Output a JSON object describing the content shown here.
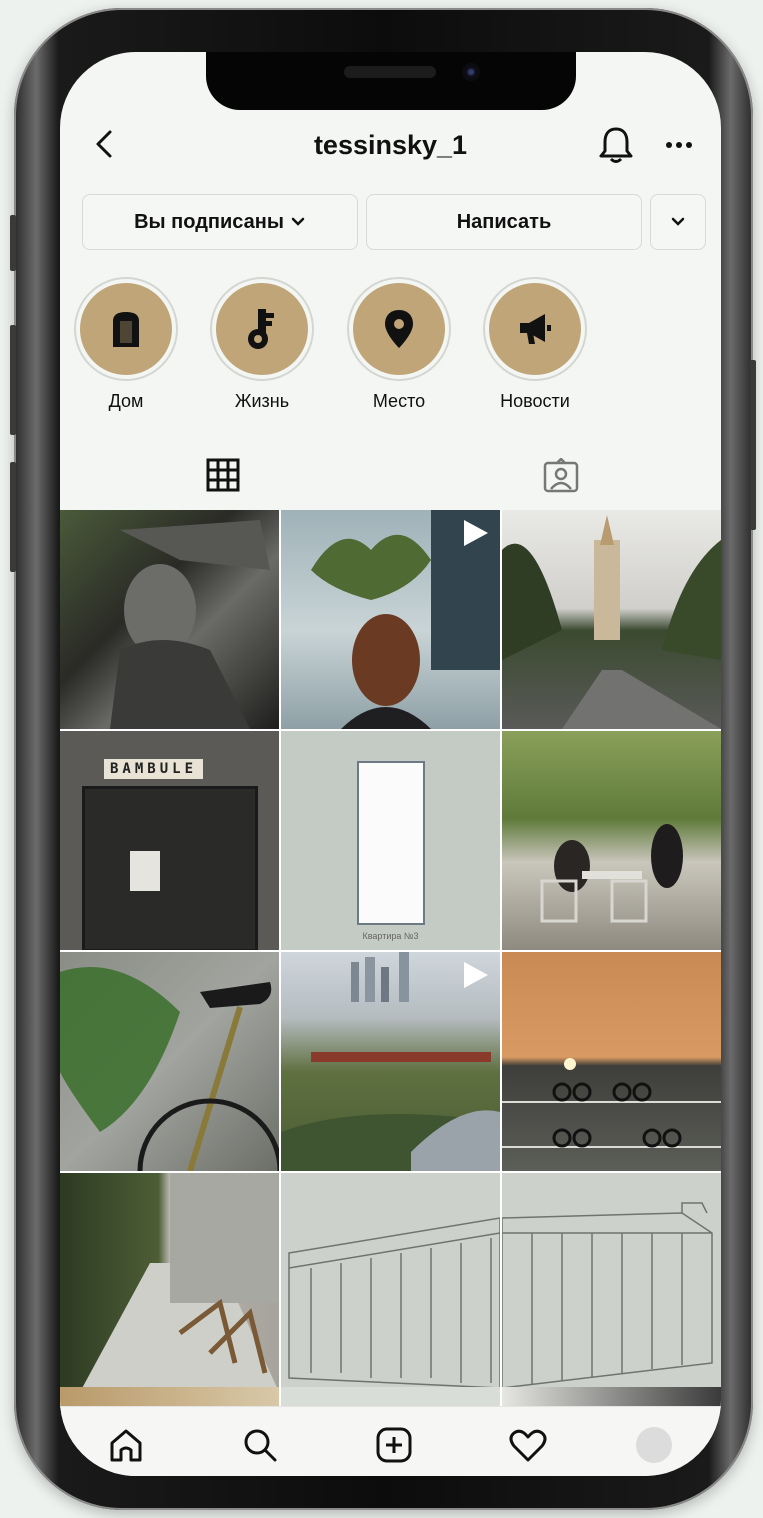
{
  "header": {
    "username": "tessinsky_1"
  },
  "actions": {
    "following_label": "Вы подписаны",
    "message_label": "Написать"
  },
  "highlights": [
    {
      "label": "Дом",
      "icon": "door-icon"
    },
    {
      "label": "Жизнь",
      "icon": "key-icon"
    },
    {
      "label": "Место",
      "icon": "location-pin-icon"
    },
    {
      "label": "Новости",
      "icon": "megaphone-icon"
    }
  ],
  "tabs": [
    "grid-icon",
    "tagged-icon"
  ],
  "posts": [
    {
      "label": "",
      "video": false
    },
    {
      "label": "",
      "video": true
    },
    {
      "label": "",
      "video": false
    },
    {
      "label": "BAMBULE",
      "video": false
    },
    {
      "label": "Квартира №3",
      "video": false
    },
    {
      "label": "",
      "video": false
    },
    {
      "label": "",
      "video": false
    },
    {
      "label": "",
      "video": true
    },
    {
      "label": "",
      "video": false
    },
    {
      "label": "",
      "video": false
    },
    {
      "label": "",
      "video": false
    },
    {
      "label": "",
      "video": false
    }
  ],
  "nav": [
    "home-icon",
    "search-icon",
    "new-post-icon",
    "activity-icon",
    "profile-avatar"
  ],
  "colors": {
    "highlight_fill": "#bfa578",
    "background": "#f3f6f2"
  }
}
